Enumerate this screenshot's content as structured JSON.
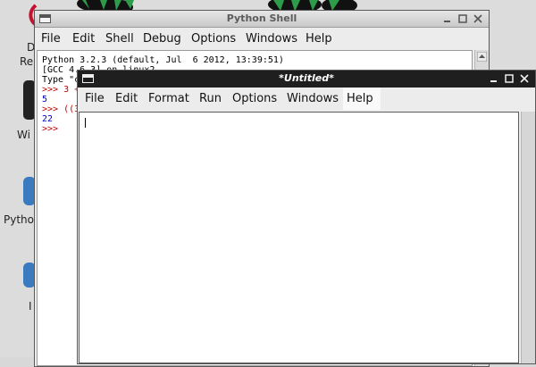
{
  "desktop": {
    "icons": [
      {
        "name": "debian-reference",
        "label_visible": "D",
        "label_visible_2": "Re"
      },
      {
        "name": "wifi-config",
        "label_visible": "Wi"
      },
      {
        "name": "python-games",
        "label_visible": "Pytho"
      },
      {
        "name": "idle",
        "label_visible": "I"
      }
    ]
  },
  "shell_window": {
    "title": "Python Shell",
    "menu": [
      "File",
      "Edit",
      "Shell",
      "Debug",
      "Options",
      "Windows",
      "Help"
    ],
    "lines": [
      {
        "text": "Python 3.2.3 (default, Jul  6 2012, 13:39:51)",
        "color": "#000000"
      },
      {
        "text": "[GCC 4.6.3] on linux2",
        "color": "#000000"
      },
      {
        "text": "Type \"c",
        "color": "#000000"
      },
      {
        "text": ">>> 3 +",
        "color": "#c00000"
      },
      {
        "text": "5",
        "color": "#0000c0"
      },
      {
        "text": ">>> ((3",
        "color": "#c00000"
      },
      {
        "text": "22",
        "color": "#0000c0"
      },
      {
        "text": ">>>",
        "color": "#c00000"
      }
    ]
  },
  "editor_window": {
    "title": "*Untitled*",
    "menu": [
      "File",
      "Edit",
      "Format",
      "Run",
      "Options",
      "Windows",
      "Help"
    ],
    "active_menu": "Help",
    "content": ""
  },
  "colors": {
    "editor_titlebar": "#1f1f1f",
    "shell_titlebar": "#d4d4d4",
    "prompt": "#c00000",
    "output": "#0000c0"
  }
}
